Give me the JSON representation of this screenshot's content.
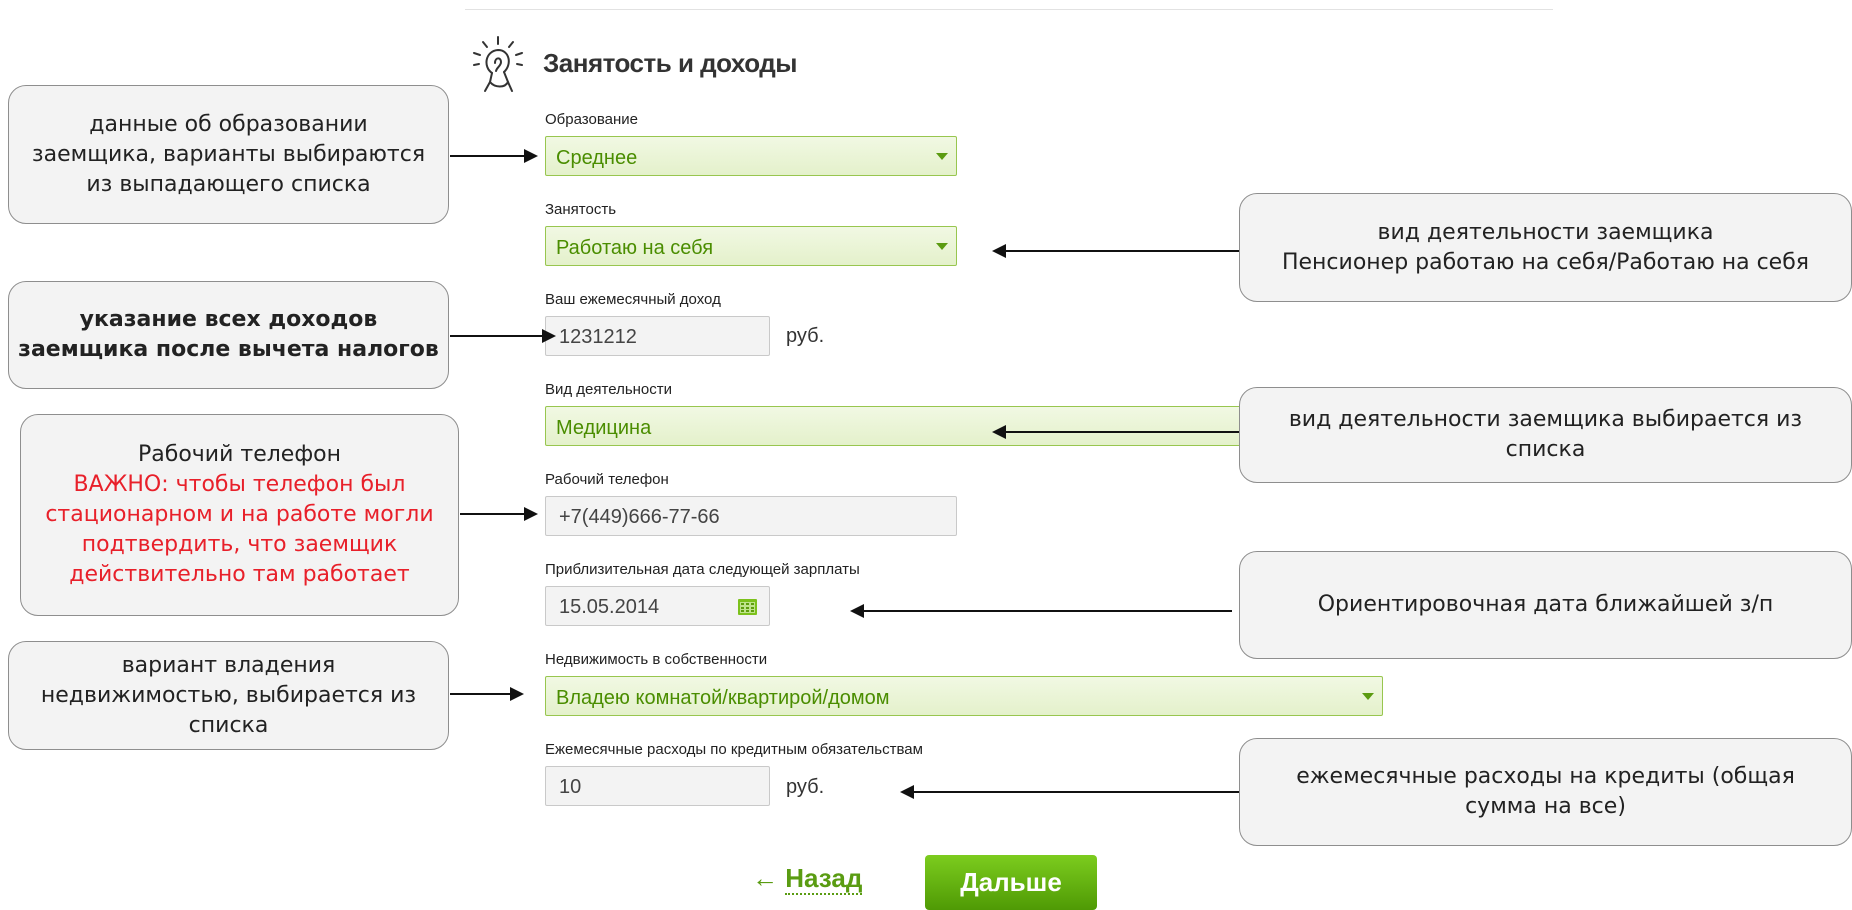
{
  "section": {
    "title": "Занятость и доходы",
    "icon": "lightbulb-hand-icon"
  },
  "fields": {
    "education": {
      "label": "Образование",
      "value": "Среднее"
    },
    "employment": {
      "label": "Занятость",
      "value": "Работаю на себя"
    },
    "income": {
      "label": "Ваш ежемесячный доход",
      "value": "1231212",
      "unit": "руб."
    },
    "activity": {
      "label": "Вид деятельности",
      "value": "Медицина"
    },
    "work_phone": {
      "label": "Рабочий телефон",
      "value": "+7(449)666-77-66"
    },
    "salary_date": {
      "label": "Приблизительная дата следующей зарплаты",
      "value": "15.05.2014"
    },
    "property": {
      "label": "Недвижимость в собственности",
      "value": "Владею комнатой/квартирой/домом"
    },
    "credit_expenses": {
      "label": "Ежемесячные расходы по кредитным обязательствам",
      "value": "10",
      "unit": "руб."
    }
  },
  "buttons": {
    "back_arrow": "←",
    "back": "Назад",
    "next": "Дальше"
  },
  "callouts": {
    "education": [
      "данные об образовании",
      "заемщика, варианты выбираются",
      "из выпадающего списка"
    ],
    "income": [
      "указание всех доходов",
      "заемщика после вычета налогов"
    ],
    "phone_title": "Рабочий телефон",
    "phone_warning": [
      "ВАЖНО: чтобы телефон был",
      "стационарном и на работе могли",
      "подтвердить, что заемщик",
      "действительно там работает"
    ],
    "property": [
      "вариант владения",
      "недвижимостью, выбирается из",
      "списка"
    ],
    "employment": [
      "вид деятельности заемщика",
      "Пенсионер работаю на себя/Работаю на себя"
    ],
    "activity": [
      "вид деятельности заемщика выбирается из",
      "списка"
    ],
    "salary_date": [
      "Ориентировочная дата ближайшей з/п"
    ],
    "credits": [
      "ежемесячные расходы на кредиты (общая",
      "сумма на все)"
    ]
  },
  "colors": {
    "accent_green": "#5a9c12",
    "select_border": "#98c64f",
    "warning_red": "#e8202a"
  }
}
